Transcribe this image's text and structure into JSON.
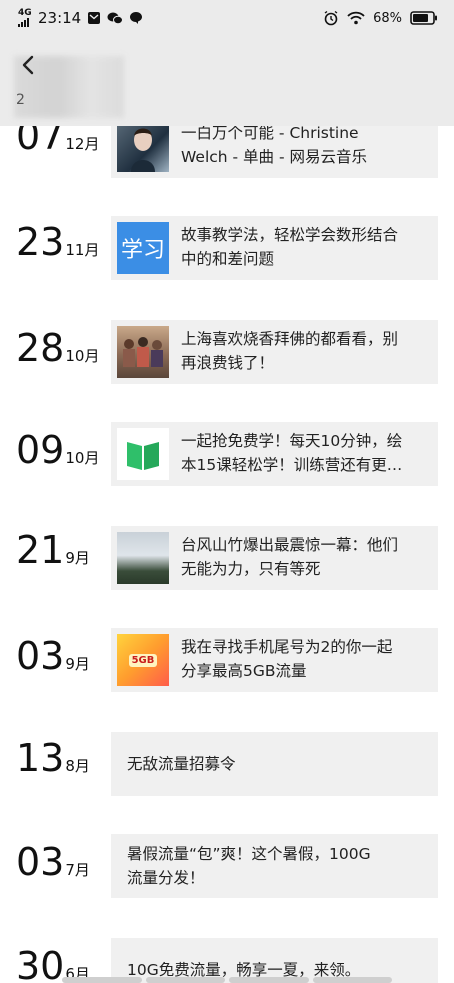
{
  "status_bar": {
    "network": "4G",
    "time": "23:14",
    "battery": "68%",
    "icons_left": [
      "signal-icon",
      "mail-notification-icon",
      "wechat-icon",
      "message-icon"
    ],
    "icons_right": [
      "alarm-icon",
      "wifi-icon",
      "battery-icon"
    ]
  },
  "header": {
    "back_icon": "back-arrow-icon",
    "year_partial": "2"
  },
  "posts": [
    {
      "day": "07",
      "month": "12月",
      "text": "一白万个可能 - Christine\nWelch - 单曲 - 网易云音乐",
      "thumb": "music-cover",
      "kind": "image"
    },
    {
      "day": "23",
      "month": "11月",
      "text": "故事教学法，轻松学会数形结合\n中的和差问题",
      "thumb": "study-icon",
      "thumb_label": "学习",
      "kind": "image"
    },
    {
      "day": "28",
      "month": "10月",
      "text": "上海喜欢烧香拜佛的都看看，别\n再浪费钱了！",
      "thumb": "crowd-photo",
      "kind": "image"
    },
    {
      "day": "09",
      "month": "10月",
      "text": "一起抢免费学！每天10分钟，绘\n本15课轻松学！训练营还有更…",
      "thumb": "book-logo",
      "kind": "image"
    },
    {
      "day": "21",
      "month": "9月",
      "text": "台风山竹爆出最震惊一幕：他们\n无能为力，只有等死",
      "thumb": "typhoon-photo",
      "kind": "image"
    },
    {
      "day": "03",
      "month": "9月",
      "text": "我在寻找手机尾号为2的你一起\n分享最高5GB流量",
      "thumb": "promo-banner",
      "thumb_label": "5GB",
      "kind": "image"
    },
    {
      "day": "13",
      "month": "8月",
      "text": "无敌流量招募令",
      "kind": "text"
    },
    {
      "day": "03",
      "month": "7月",
      "text": "暑假流量“包”爽！这个暑假，100G\n流量分发！",
      "kind": "text"
    },
    {
      "day": "30",
      "month": "6月",
      "text": "10G免费流量，畅享一夏，来领。",
      "kind": "text"
    }
  ],
  "colors": {
    "header_bg": "#ebebeb",
    "card_bg": "#f0f0f0",
    "book_green": "#2fbf6a",
    "study_blue": "#3b8ee5"
  }
}
